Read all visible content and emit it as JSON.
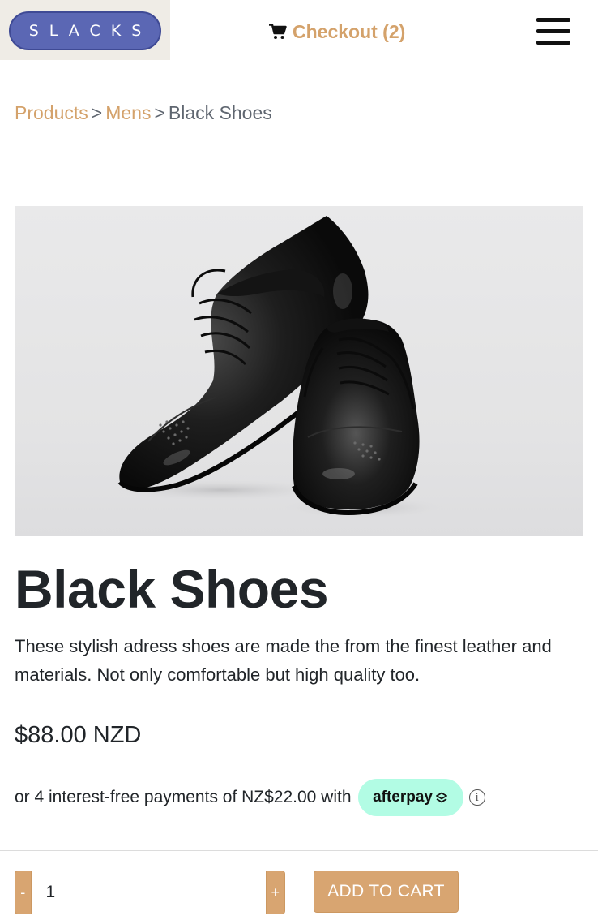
{
  "header": {
    "logo_text": "SLACKS",
    "checkout_label": "Checkout (2)",
    "menu_icon": "hamburger-menu-icon",
    "cart_icon": "shopping-cart-icon"
  },
  "breadcrumb": {
    "items": [
      "Products",
      "Mens"
    ],
    "separator": ">",
    "current": "Black Shoes"
  },
  "product": {
    "image_alt": "Black Shoes",
    "title": "Black Shoes",
    "description": "These stylish adress shoes are made the from the finest leather and materials. Not only comfortable but high quality too.",
    "price": "$88.00 NZD",
    "afterpay_text": "or 4 interest-free payments of NZ$22.00 with",
    "afterpay_brand": "afterpay",
    "info_icon_glyph": "i"
  },
  "cart_controls": {
    "minus_label": "-",
    "quantity_value": "1",
    "plus_label": "+",
    "add_to_cart_label": "ADD TO CART"
  },
  "colors": {
    "accent": "#d4a26b",
    "button": "#d8a571",
    "logo": "#5b67b4",
    "afterpay": "#b2fce4"
  }
}
